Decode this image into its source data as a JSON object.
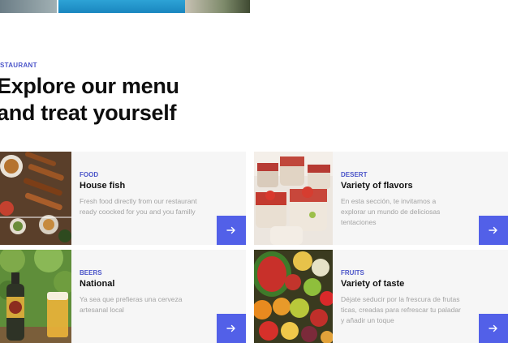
{
  "section": {
    "eyebrow": "STAURANT",
    "heading_line1": "Explore our menu",
    "heading_line2": "and treat yourself"
  },
  "cards": [
    {
      "category": "FOOD",
      "title": "House fish",
      "description": "Fresh food directly from our restaurant ready coocked for you and you familly",
      "icon": "arrow-right-icon"
    },
    {
      "category": "DESERT",
      "title": "Variety of flavors",
      "description": "En esta sección, te invitamos a explorar un mundo de deliciosas tentaciones",
      "icon": "arrow-right-icon"
    },
    {
      "category": "BEERS",
      "title": "National",
      "description": "Ya sea que prefieras una cerveza artesanal local",
      "icon": "arrow-right-icon"
    },
    {
      "category": "FRUITS",
      "title": "Variety of taste",
      "description": "Déjate seducir por la frescura de frutas ticas, creadas para refrescar tu paladar y añadir un toque",
      "icon": "arrow-right-icon"
    }
  ],
  "colors": {
    "accent": "#5260e8",
    "category": "#4b55c9",
    "card_bg": "#f6f6f6",
    "muted_text": "#a3a3a3"
  }
}
